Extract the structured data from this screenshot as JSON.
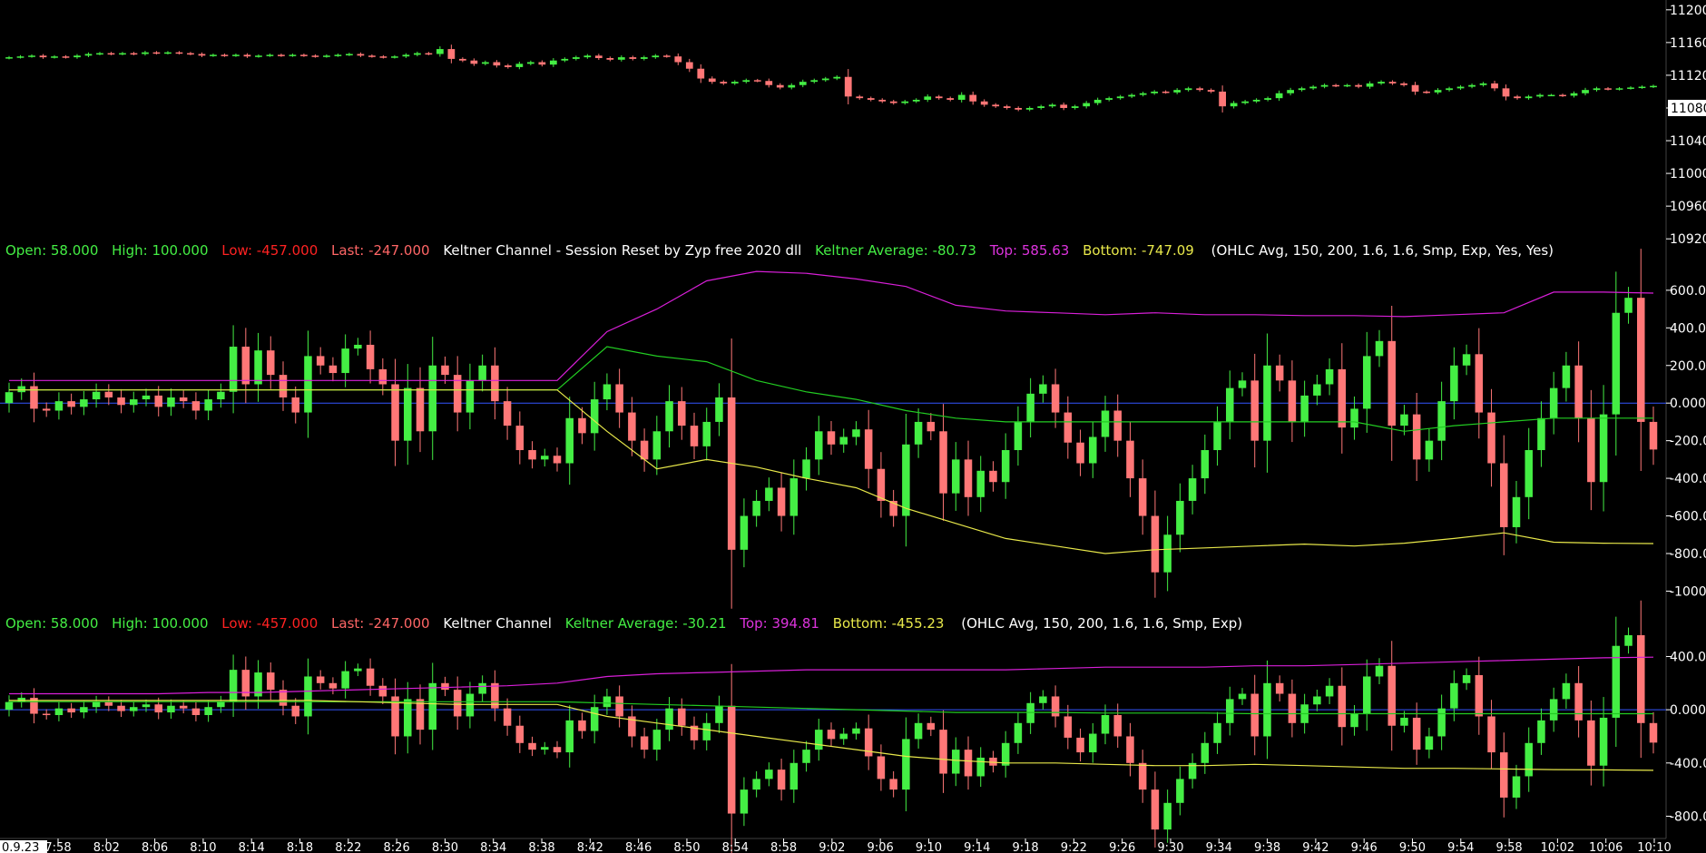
{
  "colors": {
    "background": "#000000",
    "up": "#44ee44",
    "down": "#ff7777",
    "zero_line": "#3355ff",
    "top_band": "#d81fd8",
    "avg_band": "#22cc22",
    "bottom_band": "#e8e84a",
    "axis_text": "#ffffff",
    "panel_border": "#404040"
  },
  "price_panel": {
    "ticks": [
      "11200",
      "11160",
      "11120",
      "11080",
      "11040",
      "11000",
      "10960",
      "10920"
    ],
    "tick_values": [
      11200,
      11160,
      11120,
      11080,
      11040,
      11000,
      10960,
      10920
    ],
    "current_price_label": "11080",
    "current_price": 11080
  },
  "panel2": {
    "status": {
      "open": "Open: 58.000",
      "high": "High: 100.000",
      "low": "Low: -457.000",
      "last": "Last: -247.000",
      "name": "Keltner Channel - Session Reset by Zyp free 2020 dll",
      "avg": "Keltner Average: -80.73",
      "top": "Top: 585.63",
      "bottom": "Bottom: -747.09",
      "params": "(OHLC Avg, 150, 200, 1.6, 1.6, Smp, Exp, Yes, Yes)"
    },
    "ticks": [
      "600.0",
      "400.0",
      "200.0",
      "0.000",
      "-200.0",
      "-400.0",
      "-600.0",
      "-800.0",
      "-1000"
    ],
    "tick_values": [
      600,
      400,
      200,
      0,
      -200,
      -400,
      -600,
      -800,
      -1000
    ]
  },
  "panel3": {
    "status": {
      "open": "Open: 58.000",
      "high": "High: 100.000",
      "low": "Low: -457.000",
      "last": "Last: -247.000",
      "name": "Keltner Channel",
      "avg": "Keltner Average: -30.21",
      "top": "Top: 394.81",
      "bottom": "Bottom: -455.23",
      "params": "(OHLC Avg, 150, 200, 1.6, 1.6, Smp, Exp)"
    },
    "ticks": [
      "400.0",
      "0.000",
      "-400.0",
      "-800.0"
    ],
    "tick_values": [
      400,
      0,
      -400,
      -800
    ]
  },
  "time_axis": {
    "first_label": "0.9.23",
    "labels": [
      "7:58",
      "8:02",
      "8:06",
      "8:10",
      "8:14",
      "8:18",
      "8:22",
      "8:26",
      "8:30",
      "8:34",
      "8:38",
      "8:42",
      "8:46",
      "8:50",
      "8:54",
      "8:58",
      "9:02",
      "9:06",
      "9:10",
      "9:14",
      "9:18",
      "9:22",
      "9:26",
      "9:30",
      "9:34",
      "9:38",
      "9:42",
      "9:46",
      "9:50",
      "9:54",
      "9:58",
      "10:02",
      "10:06",
      "10:10"
    ]
  },
  "chart_data": {
    "type": "candlestick",
    "panels": [
      "price",
      "keltner_session_reset",
      "keltner"
    ],
    "price_closes": [
      11142,
      11143,
      11144,
      11142,
      11143,
      11142,
      11144,
      11146,
      11147,
      11146,
      11147,
      11146,
      11148,
      11147,
      11148,
      11147,
      11146,
      11144,
      11145,
      11144,
      11145,
      11143,
      11144,
      11145,
      11144,
      11145,
      11144,
      11143,
      11144,
      11145,
      11146,
      11144,
      11143,
      11142,
      11143,
      11145,
      11147,
      11146,
      11152,
      11140,
      11138,
      11134,
      11136,
      11132,
      11130,
      11134,
      11136,
      11133,
      11138,
      11140,
      11142,
      11144,
      11141,
      11139,
      11142,
      11140,
      11142,
      11144,
      11143,
      11136,
      11128,
      11116,
      11112,
      11110,
      11112,
      11114,
      11113,
      11108,
      11105,
      11108,
      11112,
      11114,
      11116,
      11118,
      11094,
      11092,
      11090,
      11088,
      11086,
      11088,
      11090,
      11094,
      11092,
      11090,
      11096,
      11088,
      11084,
      11082,
      11080,
      11078,
      11080,
      11082,
      11084,
      11080,
      11082,
      11086,
      11090,
      11092,
      11094,
      11096,
      11098,
      11100,
      11099,
      11102,
      11104,
      11102,
      11100,
      11082,
      11086,
      11088,
      11090,
      11092,
      11098,
      11102,
      11104,
      11106,
      11108,
      11107,
      11108,
      11106,
      11110,
      11112,
      11110,
      11108,
      11100,
      11099,
      11102,
      11104,
      11106,
      11108,
      11110,
      11104,
      11094,
      11092,
      11094,
      11096,
      11096,
      11095,
      11098,
      11102,
      11104,
      11103,
      11104,
      11105,
      11106,
      11107
    ],
    "ohlc_values": [
      58,
      90,
      -30,
      -40,
      10,
      -20,
      20,
      60,
      30,
      -10,
      20,
      40,
      -20,
      30,
      10,
      -40,
      20,
      60,
      300,
      100,
      280,
      150,
      30,
      -50,
      250,
      200,
      160,
      290,
      310,
      180,
      100,
      -200,
      80,
      -150,
      200,
      150,
      -50,
      120,
      200,
      10,
      -120,
      -250,
      -300,
      -280,
      -320,
      -80,
      -160,
      20,
      100,
      -50,
      -200,
      -300,
      -150,
      10,
      -120,
      -230,
      -100,
      30,
      -780,
      -600,
      -520,
      -450,
      -600,
      -400,
      -300,
      -150,
      -220,
      -180,
      -140,
      -350,
      -520,
      -600,
      -220,
      -100,
      -150,
      -480,
      -300,
      -500,
      -360,
      -420,
      -250,
      -100,
      50,
      100,
      -50,
      -210,
      -320,
      -180,
      -40,
      -200,
      -400,
      -600,
      -900,
      -700,
      -520,
      -400,
      -250,
      -100,
      80,
      120,
      -200,
      200,
      120,
      -100,
      40,
      100,
      180,
      -130,
      -30,
      250,
      330,
      -120,
      -60,
      -300,
      -200,
      10,
      200,
      260,
      -50,
      -320,
      -660,
      -500,
      -250,
      -80,
      80,
      200,
      -80,
      -420,
      -60,
      480,
      560,
      -100,
      -247
    ],
    "session_reset_bands": {
      "top": [
        120,
        120,
        120,
        120,
        120,
        120,
        120,
        120,
        120,
        120,
        120,
        120,
        380,
        500,
        650,
        700,
        690,
        660,
        620,
        520,
        490,
        480,
        470,
        480,
        470,
        470,
        465,
        465,
        460,
        470,
        480,
        590,
        590,
        585
      ],
      "average": [
        70,
        70,
        70,
        70,
        70,
        70,
        70,
        70,
        70,
        70,
        70,
        70,
        300,
        250,
        220,
        120,
        60,
        20,
        -40,
        -80,
        -100,
        -100,
        -100,
        -100,
        -100,
        -100,
        -100,
        -100,
        -150,
        -120,
        -100,
        -80,
        -80,
        -80
      ],
      "bottom": [
        70,
        70,
        70,
        70,
        70,
        70,
        70,
        70,
        70,
        70,
        70,
        70,
        -150,
        -350,
        -300,
        -340,
        -400,
        -450,
        -560,
        -640,
        -720,
        -760,
        -800,
        -780,
        -770,
        -760,
        -750,
        -760,
        -745,
        -720,
        -690,
        -740,
        -745,
        -747
      ]
    },
    "keltner_bands": {
      "top": [
        120,
        120,
        120,
        120,
        130,
        130,
        140,
        150,
        160,
        170,
        180,
        200,
        250,
        270,
        280,
        290,
        300,
        300,
        300,
        300,
        300,
        310,
        320,
        320,
        320,
        330,
        330,
        340,
        350,
        360,
        370,
        380,
        390,
        395
      ],
      "average": [
        60,
        60,
        60,
        60,
        60,
        60,
        60,
        60,
        60,
        60,
        60,
        60,
        50,
        40,
        30,
        20,
        10,
        0,
        -10,
        -20,
        -20,
        -20,
        -25,
        -25,
        -25,
        -30,
        -30,
        -30,
        -30,
        -30,
        -30,
        -30,
        -30,
        -30
      ],
      "bottom": [
        70,
        70,
        70,
        70,
        70,
        70,
        70,
        60,
        50,
        40,
        40,
        40,
        -50,
        -100,
        -150,
        -200,
        -250,
        -300,
        -350,
        -380,
        -400,
        -400,
        -410,
        -420,
        -420,
        -410,
        -420,
        -430,
        -440,
        -440,
        -445,
        -450,
        -452,
        -455
      ]
    }
  }
}
